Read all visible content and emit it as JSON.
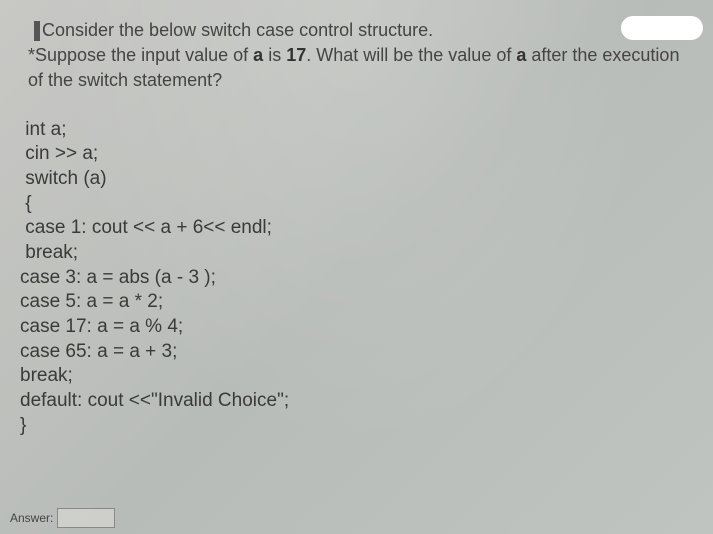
{
  "question": {
    "line1_prefix": "Consider the below switch case control structure.",
    "line2_prefix": "*Suppose the input value of ",
    "line2_bold1": "a",
    "line2_mid": " is ",
    "line2_bold2": "17",
    "line2_after": ". What will be the value of ",
    "line2_bold3": "a",
    "line2_end": " after the execution",
    "line3": "of the switch statement?"
  },
  "code": {
    "l1": " int a;",
    "l2": " cin >> a;",
    "l3": " switch (a)",
    "l4": " {",
    "l5": " case 1: cout << a + 6<< endl;",
    "l6": " break;",
    "l7": "case 3: a = abs (a - 3 );",
    "l8": "case 5: a = a * 2;",
    "l9": "case 17: a = a % 4;",
    "l10": "case 65: a = a + 3;",
    "l11": "break;",
    "l12": "default: cout <<\"Invalid Choice\";",
    "l13": "}"
  },
  "answer": {
    "label": "Answer:",
    "value": ""
  }
}
